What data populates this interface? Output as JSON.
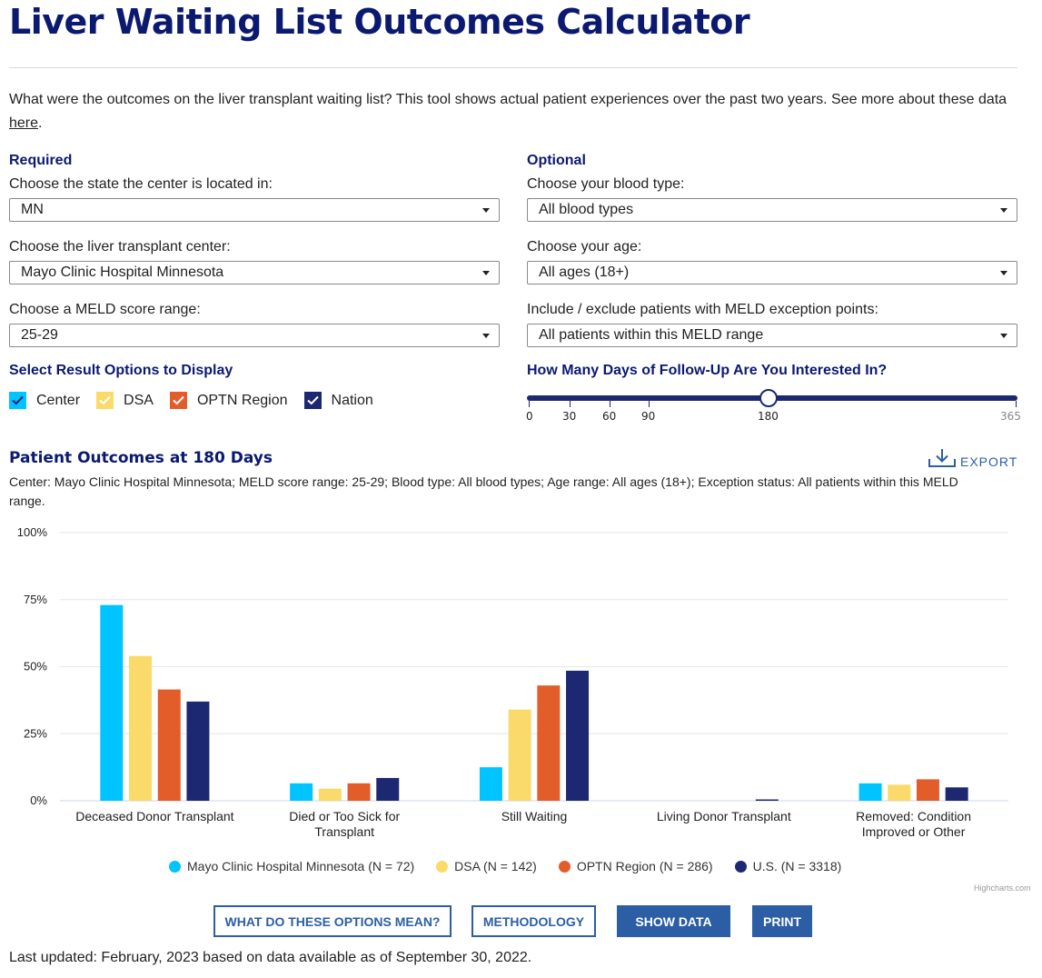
{
  "header": {
    "title": "Liver Waiting List Outcomes Calculator",
    "intro_text": "What were the outcomes on the liver transplant waiting list? This tool shows actual patient experiences over the past two years. See more about these data ",
    "intro_link": "here",
    "intro_end": "."
  },
  "required": {
    "heading": "Required",
    "state_label": "Choose the state the center is located in:",
    "state_value": "MN",
    "center_label": "Choose the liver transplant center:",
    "center_value": "Mayo Clinic Hospital Minnesota",
    "meld_label": "Choose a MELD score range:",
    "meld_value": "25-29"
  },
  "optional": {
    "heading": "Optional",
    "blood_label": "Choose your blood type:",
    "blood_value": "All blood types",
    "age_label": "Choose your age:",
    "age_value": "All ages (18+)",
    "exception_label": "Include / exclude patients with MELD exception points:",
    "exception_value": "All patients within this MELD range"
  },
  "result_options": {
    "heading": "Select Result Options to Display",
    "items": [
      {
        "label": "Center",
        "checked": true,
        "color": "#00c4ff"
      },
      {
        "label": "DSA",
        "checked": true,
        "color": "#f9da6a"
      },
      {
        "label": "OPTN Region",
        "checked": true,
        "color": "#e35d2a"
      },
      {
        "label": "Nation",
        "checked": true,
        "color": "#1d2872"
      }
    ]
  },
  "follow_up": {
    "heading": "How Many Days of Follow-Up Are You Interested In?",
    "ticks": [
      0,
      30,
      60,
      90,
      180,
      365
    ],
    "min": 0,
    "max": 365,
    "value": 180
  },
  "results": {
    "title": "Patient Outcomes at 180 Days",
    "export_label": "EXPORT",
    "filters": "Center: Mayo Clinic Hospital Minnesota; MELD score range: 25-29; Blood type: All blood types; Age range: All ages (18+); Exception status: All patients within this MELD range."
  },
  "chart_data": {
    "type": "bar",
    "categories": [
      "Deceased Donor Transplant",
      "Died or Too Sick for Transplant",
      "Still Waiting",
      "Living Donor Transplant",
      "Removed: Condition Improved or Other"
    ],
    "series": [
      {
        "name": "Mayo Clinic Hospital Minnesota (N = 72)",
        "color": "#00c4ff",
        "values": [
          73,
          6.5,
          12.5,
          0,
          6.5
        ]
      },
      {
        "name": "DSA (N = 142)",
        "color": "#f9da6a",
        "values": [
          54,
          4.5,
          34,
          0,
          6
        ]
      },
      {
        "name": "OPTN Region (N = 286)",
        "color": "#e35d2a",
        "values": [
          41.5,
          6.5,
          43,
          0,
          8
        ]
      },
      {
        "name": "U.S. (N = 3318)",
        "color": "#1d2872",
        "values": [
          37,
          8.5,
          48.5,
          0.5,
          5
        ]
      }
    ],
    "y_ticks": [
      "0%",
      "25%",
      "50%",
      "75%",
      "100%"
    ],
    "ylim": [
      0,
      100
    ],
    "grid": true,
    "legend_position": "bottom-center",
    "credit": "Highcharts.com"
  },
  "buttons": {
    "options_meaning": "WHAT DO THESE OPTIONS MEAN?",
    "methodology": "METHODOLOGY",
    "show_data": "SHOW DATA",
    "print": "PRINT"
  },
  "footer": {
    "updated": "Last updated: February, 2023 based on data available as of September 30, 2022."
  },
  "icons": {
    "export": "download-icon",
    "dropdown": "caret-down-icon",
    "checkbox": "checkmark-icon"
  }
}
